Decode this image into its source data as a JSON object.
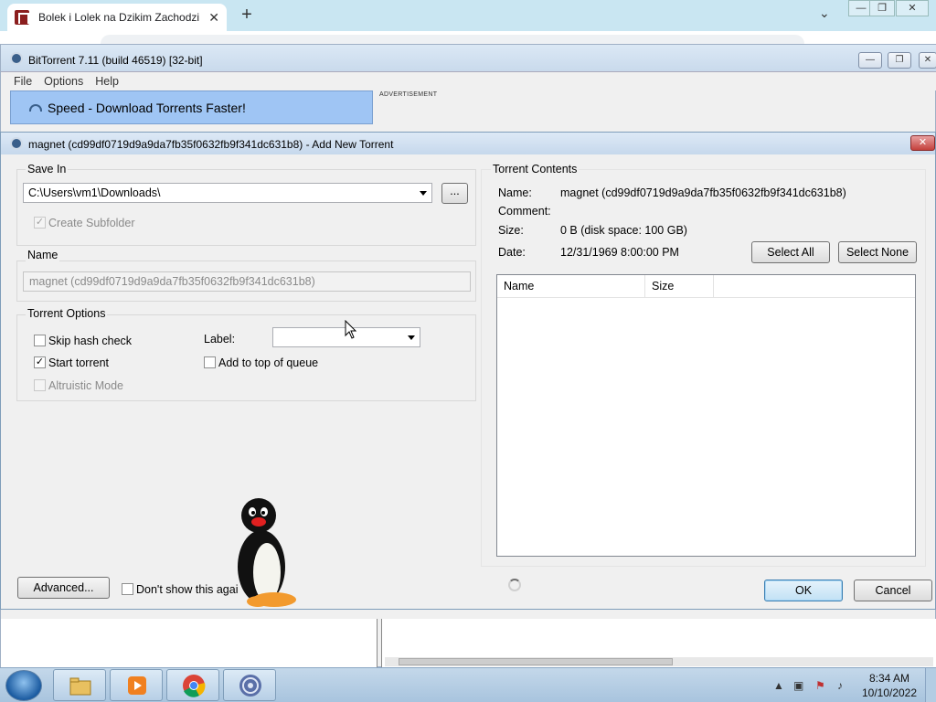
{
  "browser": {
    "tab_title": "Bolek i Lolek na Dzikim Zachodzi",
    "tab_close": "✕",
    "new_tab": "+",
    "chevron": "⌄",
    "window_buttons": [
      "—",
      "❐",
      "✕"
    ]
  },
  "bittorrent": {
    "title": "BitTorrent 7.11  (build 46519) [32-bit]",
    "menu": [
      "File",
      "Options",
      "Help"
    ],
    "promo_text": "Speed - Download Torrents Faster!",
    "ad_label": "ADVERTISEMENT"
  },
  "dialog": {
    "title": "magnet (cd99df0719d9a9da7fb35f0632fb9f341dc631b8) - Add New Torrent",
    "close": "✕",
    "save_in": {
      "group_title": "Save In",
      "path": "C:\\Users\\vm1\\Downloads\\",
      "browse_label": "...",
      "create_subfolder_label": "Create Subfolder",
      "create_subfolder_checked": true
    },
    "name": {
      "group_title": "Name",
      "value": "magnet (cd99df0719d9a9da7fb35f0632fb9f341dc631b8)"
    },
    "torrent_options": {
      "group_title": "Torrent Options",
      "skip_hash_label": "Skip hash check",
      "skip_hash_checked": false,
      "start_torrent_label": "Start torrent",
      "start_torrent_checked": true,
      "altruistic_label": "Altruistic Mode",
      "altruistic_checked": false,
      "label_label": "Label:",
      "label_value": "",
      "add_top_label": "Add to top of queue",
      "add_top_checked": false
    },
    "contents": {
      "group_title": "Torrent Contents",
      "name_label": "Name:",
      "name_value": "magnet (cd99df0719d9a9da7fb35f0632fb9f341dc631b8)",
      "comment_label": "Comment:",
      "comment_value": "",
      "size_label": "Size:",
      "size_value": "0 B (disk space: 100 GB)",
      "date_label": "Date:",
      "date_value": "12/31/1969 8:00:00 PM",
      "select_all": "Select All",
      "select_none": "Select None",
      "columns": [
        "Name",
        "Size"
      ]
    },
    "advanced_label": "Advanced...",
    "dont_show_label": "Don't show this agai",
    "dont_show_checked": false,
    "ok_label": "OK",
    "cancel_label": "Cancel"
  },
  "taskbar": {
    "time": "8:34 AM",
    "date": "10/10/2022",
    "apps": [
      "file-explorer-icon",
      "media-player-icon",
      "chrome-icon",
      "bittorrent-icon"
    ]
  },
  "colors": {
    "promo_bg": "#9fc5f4",
    "dialog_bg": "#f0f0f0",
    "close_red": "#c4403c",
    "browser_tabbar": "#c9e6f2"
  }
}
